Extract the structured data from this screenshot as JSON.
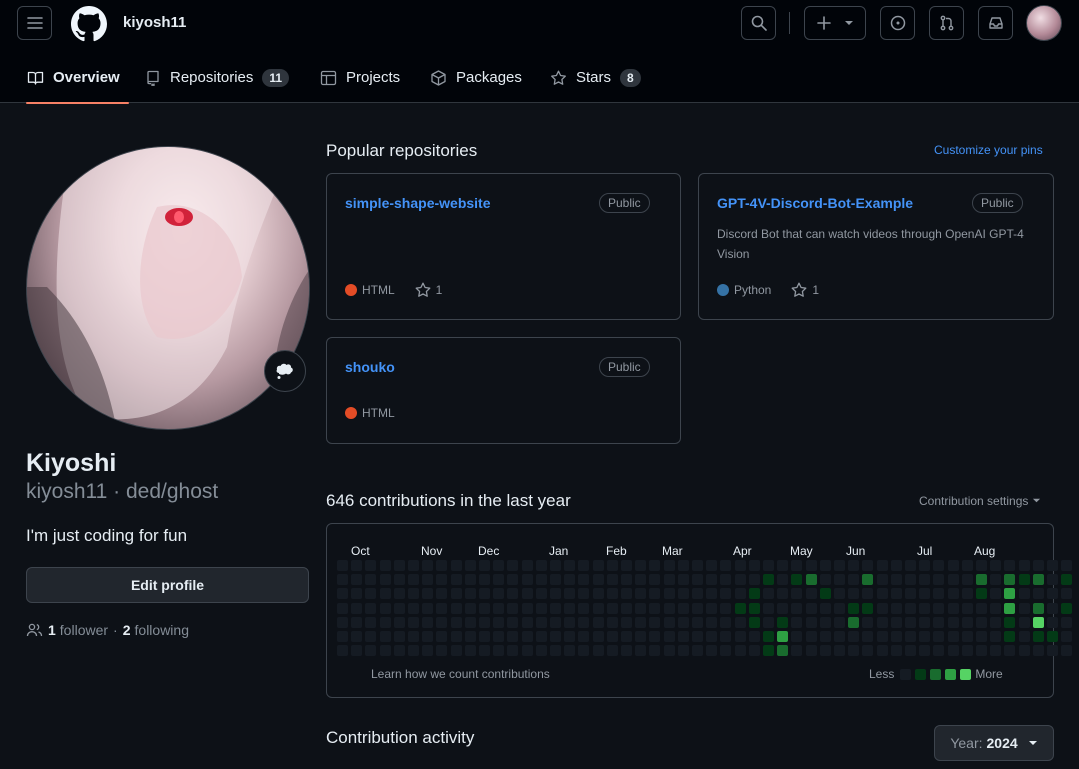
{
  "header": {
    "username": "kiyosh11",
    "icons": [
      "menu-icon",
      "github-logo-icon",
      "search-icon",
      "plus-icon",
      "chevron-down-icon",
      "issues-icon",
      "pull-request-icon",
      "inbox-icon"
    ]
  },
  "tabs": [
    {
      "label": "Overview",
      "icon": "book-icon",
      "active": true
    },
    {
      "label": "Repositories",
      "icon": "repo-icon",
      "count": "11"
    },
    {
      "label": "Projects",
      "icon": "table-icon"
    },
    {
      "label": "Packages",
      "icon": "package-icon"
    },
    {
      "label": "Stars",
      "icon": "star-icon",
      "count": "8"
    }
  ],
  "profile": {
    "name": "Kiyoshi",
    "login_line": "kiyosh11 · ded/ghost",
    "bio": "I'm just coding for fun",
    "edit_label": "Edit profile",
    "followers_count": "1",
    "followers_label": "follower",
    "separator": "·",
    "following_count": "2",
    "following_label": "following"
  },
  "popular": {
    "title": "Popular repositories",
    "customize_label": "Customize your pins",
    "repos": [
      {
        "name": "simple-shape-website",
        "visibility": "Public",
        "description": "",
        "language": "HTML",
        "language_color": "#e34c26",
        "stars": "1"
      },
      {
        "name": "GPT-4V-Discord-Bot-Example",
        "visibility": "Public",
        "description": "Discord Bot that can watch videos through OpenAI GPT-4 Vision",
        "language": "Python",
        "language_color": "#3572a5",
        "stars": "1"
      },
      {
        "name": "shouko",
        "visibility": "Public",
        "description": "",
        "language": "HTML",
        "language_color": "#e34c26",
        "stars": ""
      }
    ]
  },
  "contributions": {
    "title": "646 contributions in the last year",
    "settings_label": "Contribution settings",
    "months": [
      "Oct",
      "Nov",
      "Dec",
      "Jan",
      "Feb",
      "Mar",
      "Apr",
      "May",
      "Jun",
      "Jul",
      "Aug"
    ],
    "learn_label": "Learn how we count contributions",
    "legend_less": "Less",
    "legend_more": "More",
    "colors": [
      "#151b23",
      "#033a16",
      "#196c2e",
      "#2ea043",
      "#56d364"
    ],
    "levels": [
      "0000000000000000000000000000000000000000000000000000",
      "0000000000000000000000000000000000000000000000000000",
      "0000000000000000000000000000000000000000000000000000",
      "0000000000000000000000000000000000000000000000000000",
      "0000000000000000000000000000000000000000000000000000",
      "0000000000000000000000000000000000000000000000000000",
      "0000000000000000000000000000000000000000000000000000",
      "0000000000000000000000000000000000000000000000000000",
      "0000000000000000000000000000000000000000000000000000",
      "0000000000000000000000000000000000000000000000000000",
      "0000000000000000000000000000000000000000000000000000",
      "0000000000000000000000000000000000000000000000000000",
      "0000000000000000000000000000000000000000000000000000",
      "0000000000000000000000000000000000000000000000000000",
      "0000000000000000000000000000000000000000000000000000",
      "0000000000000000000000000000000000000000000000000000",
      "0000000000000000000000000000000000000000000000000000",
      "0000000000000000000000000000000000000000000000000000",
      "0000000000000000000000000000000000000000000000000000",
      "0000000000000000000000000000000000000000000000000000",
      "0000000000000000000000000000000000000000000000000000",
      "0000000000000000000000000000000000000000000000000000",
      "0000000000000000000000000000000000000000000000000000",
      "0000000000000000000000000000000000000000000000000000",
      "0000000000000000000000000000000000000000000000000000",
      "0000000000000000000000000000000000000000000000000000",
      "0000000000000000000000000000000000000000000000000000",
      "0000000000000000000000000000000000000000000000000000",
      "0000000000000000000000000000000000000000000000000000",
      "0000000000000000000000000000000000000000000000000000",
      "0000000000000000000000000000000000000000000000000000",
      "0000000000000000000000000000000000000000000000000000",
      "0000000000000000000000000000000000000000000000000000",
      "0000000000000000000000000000000000000000000000000000",
      "0000000000000000000000000000000000000000000000000000",
      "0000000000000000000000000000000000000000000000000000",
      "0000000000000000000000000000000000000000000000000000",
      "0000000000000000000000000000000000000000000000000000",
      "0000000000000000000000000000000000000000000000000000",
      "0000000000000000000000000000000000000000000000000000",
      "0000000000000000000000000000000000000000000000000000",
      "0000000000000000000000000000000000000000000000000000",
      "0000000000000000000000000000000000000000000000000000",
      "0000000000000000000000000000000000000000000000000000",
      "0000000000000000000000000000000000000000000000000000",
      "0000000000000000000000000000000000000000000000000000",
      "0000000000000000000000000000000000000000000000000000",
      "0000000000000000000000000000000000000000000000000000",
      "0000000000000000000000000000000000000000000000000000",
      "0000000000000000000000000000000000000000000000000000",
      "0000000000000000000000000000000000000000000000000000",
      "0000000000000000000000000000000000000000000000000000"
    ],
    "week_levels": [
      [
        0,
        0,
        0,
        0,
        0,
        0,
        0
      ],
      [
        0,
        0,
        0,
        0,
        0,
        0,
        0
      ],
      [
        0,
        0,
        0,
        0,
        0,
        0,
        0
      ],
      [
        0,
        0,
        0,
        0,
        0,
        0,
        0
      ],
      [
        0,
        0,
        0,
        0,
        0,
        0,
        0
      ],
      [
        0,
        0,
        0,
        0,
        0,
        0,
        0
      ],
      [
        0,
        0,
        0,
        0,
        0,
        0,
        0
      ],
      [
        0,
        0,
        0,
        0,
        0,
        0,
        0
      ],
      [
        0,
        0,
        0,
        0,
        0,
        0,
        0
      ],
      [
        0,
        0,
        0,
        0,
        0,
        0,
        0
      ],
      [
        0,
        0,
        0,
        0,
        0,
        0,
        0
      ],
      [
        0,
        0,
        0,
        0,
        0,
        0,
        0
      ],
      [
        0,
        0,
        0,
        0,
        0,
        0,
        0
      ],
      [
        0,
        0,
        0,
        0,
        0,
        0,
        0
      ],
      [
        0,
        0,
        0,
        0,
        0,
        0,
        0
      ],
      [
        0,
        0,
        0,
        0,
        0,
        0,
        0
      ],
      [
        0,
        0,
        0,
        0,
        0,
        0,
        0
      ],
      [
        0,
        0,
        0,
        0,
        0,
        0,
        0
      ],
      [
        0,
        0,
        0,
        0,
        0,
        0,
        0
      ],
      [
        0,
        0,
        0,
        0,
        0,
        0,
        0
      ],
      [
        0,
        0,
        0,
        0,
        0,
        0,
        0
      ],
      [
        0,
        0,
        0,
        0,
        0,
        0,
        0
      ],
      [
        0,
        0,
        0,
        0,
        0,
        0,
        0
      ],
      [
        0,
        0,
        0,
        0,
        0,
        0,
        0
      ],
      [
        0,
        0,
        0,
        0,
        0,
        0,
        0
      ],
      [
        0,
        0,
        0,
        0,
        0,
        0,
        0
      ],
      [
        0,
        0,
        0,
        0,
        0,
        0,
        0
      ],
      [
        0,
        0,
        0,
        0,
        0,
        0,
        0
      ],
      [
        0,
        0,
        0,
        1,
        0,
        0,
        0
      ],
      [
        0,
        0,
        1,
        1,
        1,
        0,
        0
      ],
      [
        0,
        1,
        0,
        0,
        0,
        1,
        1
      ],
      [
        0,
        0,
        0,
        0,
        1,
        3,
        2
      ],
      [
        0,
        1,
        0,
        0,
        0,
        0,
        0
      ],
      [
        0,
        2,
        0,
        0,
        0,
        0,
        0
      ],
      [
        0,
        0,
        1,
        0,
        0,
        0,
        0
      ],
      [
        0,
        0,
        0,
        0,
        0,
        0,
        0
      ],
      [
        0,
        0,
        0,
        1,
        2,
        0,
        0
      ],
      [
        0,
        2,
        0,
        1,
        0,
        0,
        0
      ],
      [
        0,
        0,
        0,
        0,
        0,
        0,
        0
      ],
      [
        0,
        0,
        0,
        0,
        0,
        0,
        0
      ],
      [
        0,
        0,
        0,
        0,
        0,
        0,
        0
      ],
      [
        0,
        0,
        0,
        0,
        0,
        0,
        0
      ],
      [
        0,
        0,
        0,
        0,
        0,
        0,
        0
      ],
      [
        0,
        0,
        0,
        0,
        0,
        0,
        0
      ],
      [
        0,
        0,
        0,
        0,
        0,
        0,
        0
      ],
      [
        0,
        2,
        1,
        0,
        0,
        0,
        0
      ],
      [
        0,
        0,
        0,
        0,
        0,
        0,
        0
      ],
      [
        0,
        2,
        3,
        3,
        1,
        1,
        0
      ],
      [
        0,
        1,
        0,
        0,
        0,
        0,
        0
      ],
      [
        0,
        2,
        0,
        2,
        4,
        1,
        0
      ],
      [
        0,
        0,
        0,
        0,
        0,
        1,
        0
      ],
      [
        0,
        1,
        0,
        1,
        0,
        0,
        0
      ]
    ]
  },
  "activity": {
    "title": "Contribution activity",
    "year_prefix": "Year:",
    "year": "2024"
  }
}
